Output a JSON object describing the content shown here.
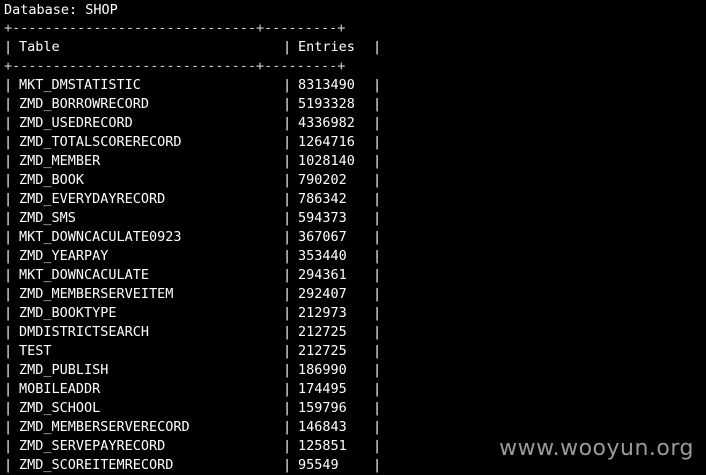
{
  "database_line": "Database: SHOP",
  "border_line": "+------------------------------+---------+",
  "headers": {
    "table": "Table",
    "entries": "Entries"
  },
  "rows": [
    {
      "table": "MKT_DMSTATISTIC",
      "entries": "8313490"
    },
    {
      "table": "ZMD_BORROWRECORD",
      "entries": "5193328"
    },
    {
      "table": "ZMD_USEDRECORD",
      "entries": "4336982"
    },
    {
      "table": "ZMD_TOTALSCORERECORD",
      "entries": "1264716"
    },
    {
      "table": "ZMD_MEMBER",
      "entries": "1028140"
    },
    {
      "table": "ZMD_BOOK",
      "entries": "790202"
    },
    {
      "table": "ZMD_EVERYDAYRECORD",
      "entries": "786342"
    },
    {
      "table": "ZMD_SMS",
      "entries": "594373"
    },
    {
      "table": "MKT_DOWNCACULATE0923",
      "entries": "367067"
    },
    {
      "table": "ZMD_YEARPAY",
      "entries": "353440"
    },
    {
      "table": "MKT_DOWNCACULATE",
      "entries": "294361"
    },
    {
      "table": "ZMD_MEMBERSERVEITEM",
      "entries": "292407"
    },
    {
      "table": "ZMD_BOOKTYPE",
      "entries": "212973"
    },
    {
      "table": "DMDISTRICTSEARCH",
      "entries": "212725"
    },
    {
      "table": "TEST",
      "entries": "212725"
    },
    {
      "table": "ZMD_PUBLISH",
      "entries": "186990"
    },
    {
      "table": "MOBILEADDR",
      "entries": "174495"
    },
    {
      "table": "ZMD_SCHOOL",
      "entries": "159796"
    },
    {
      "table": "ZMD_MEMBERSERVERECORD",
      "entries": "146843"
    },
    {
      "table": "ZMD_SERVEPAYRECORD",
      "entries": "125851"
    },
    {
      "table": "ZMD_SCOREITEMRECORD",
      "entries": "95549"
    }
  ],
  "watermark": "www.wooyun.org",
  "colors": {
    "background": "#000000",
    "text": "#ffffff",
    "watermark": "#9a9a9a"
  }
}
